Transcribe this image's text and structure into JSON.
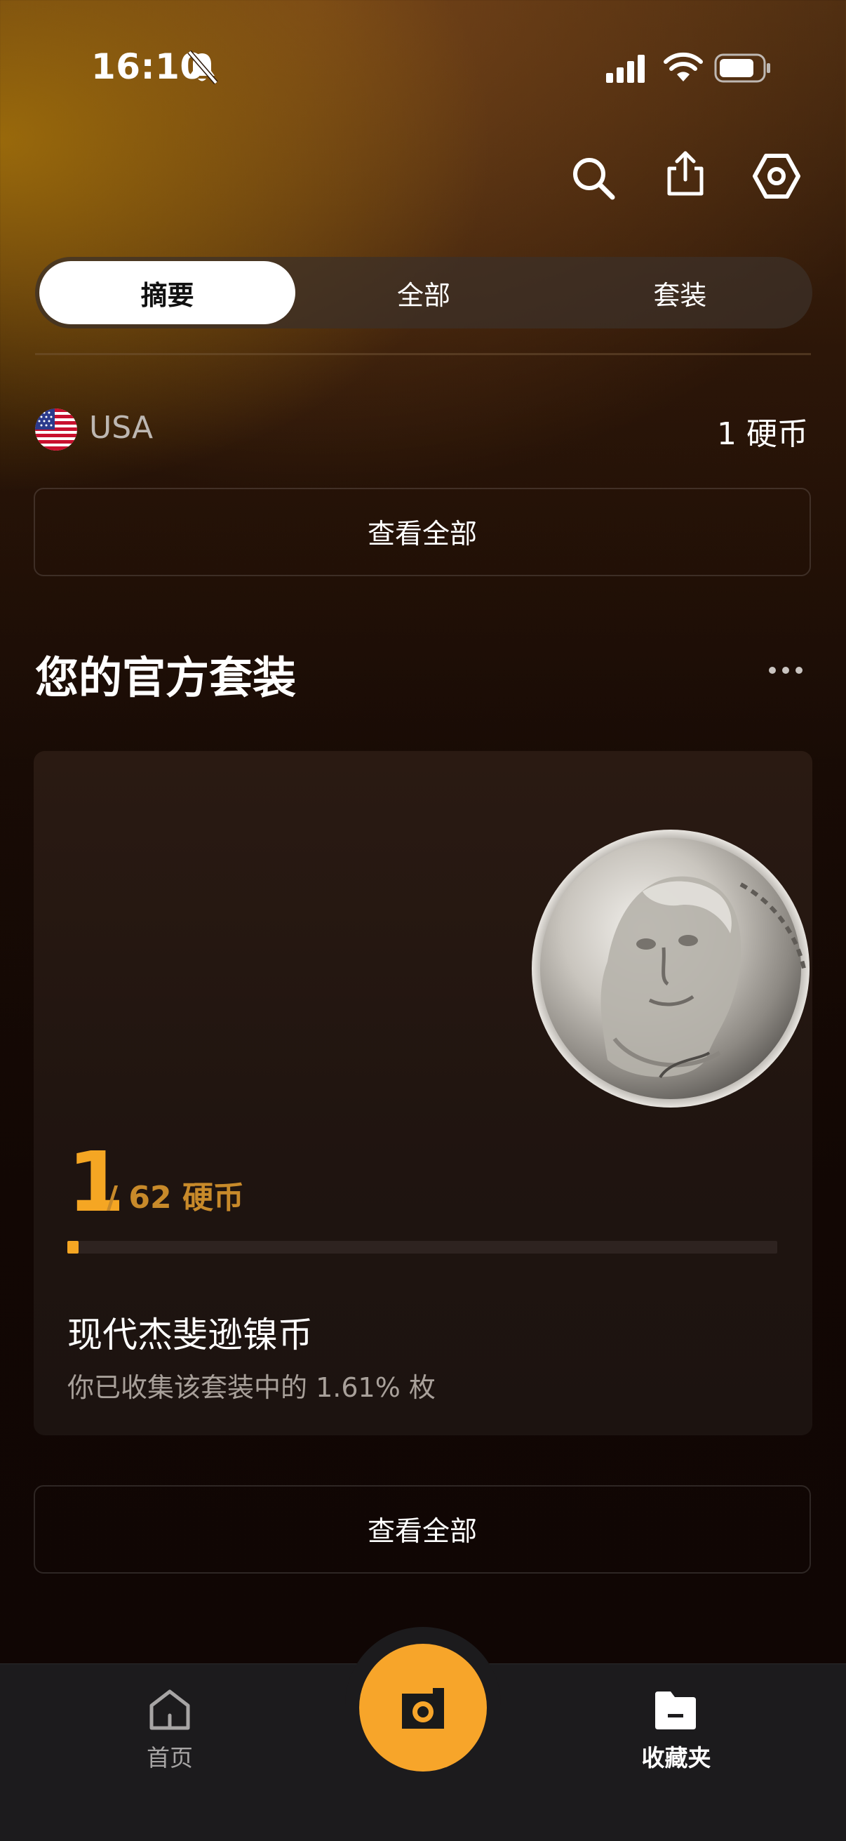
{
  "status_bar": {
    "time": "16:10"
  },
  "tabs": {
    "summary": "摘要",
    "all": "全部",
    "sets": "套装"
  },
  "country_row": {
    "country": "USA",
    "count": "1 硬币"
  },
  "view_all_label": "查看全部",
  "sets_section": {
    "title": "您的官方套装",
    "card": {
      "collected": "1",
      "total": "/ 62 硬币",
      "progress_fraction": 0.0161,
      "name": "现代杰斐逊镍币",
      "description": "你已收集该套装中的 1.61% 枚"
    }
  },
  "bottom_nav": {
    "home_label": "首页",
    "favorites_label": "收藏夹"
  },
  "colors": {
    "accent": "#f5a623",
    "camera_button": "#f7a52a",
    "tabbar": "#1c1b1d"
  }
}
